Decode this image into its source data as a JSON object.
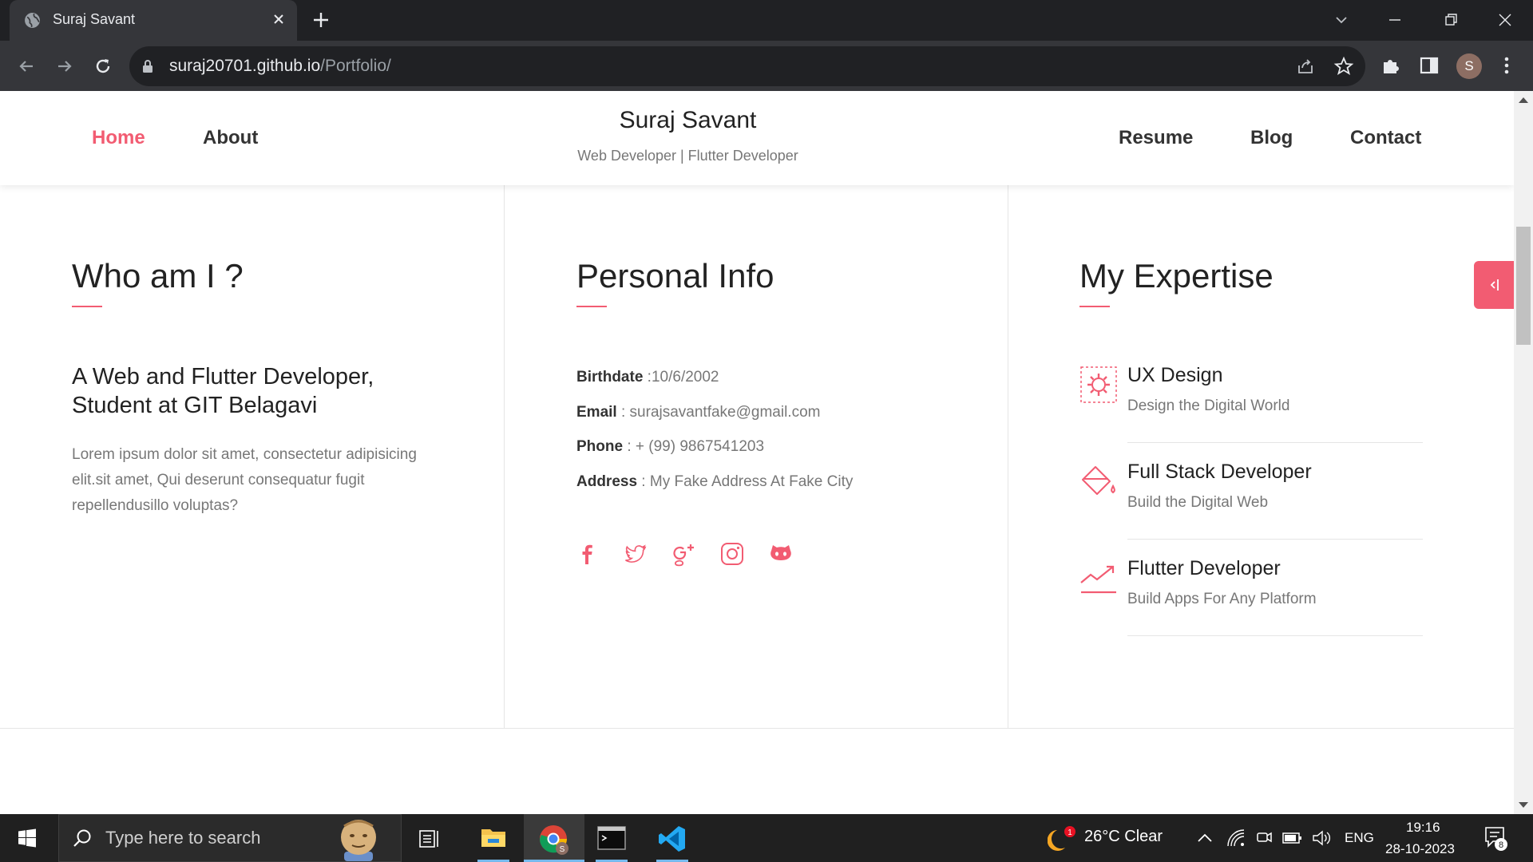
{
  "browser": {
    "tab_title": "Suraj Savant",
    "url_host": "suraj20701.github.io",
    "url_path": "/Portfolio/",
    "profile_initial": "S"
  },
  "header": {
    "nav_left": [
      "Home",
      "About"
    ],
    "nav_right": [
      "Resume",
      "Blog",
      "Contact"
    ],
    "brand_name": "Suraj Savant",
    "brand_sub": "Web Developer | Flutter Developer"
  },
  "about": {
    "title": "Who am I ?",
    "heading_line1": "A Web and Flutter Developer,",
    "heading_line2": "Student at GIT Belagavi",
    "text": "Lorem ipsum dolor sit amet, consectetur adipisicing elit.sit amet, Qui deserunt consequatur fugit repellendusillo voluptas?"
  },
  "personal": {
    "title": "Personal Info",
    "rows": [
      {
        "label": "Birthdate",
        "sep": " :",
        "value": "10/6/2002"
      },
      {
        "label": "Email",
        "sep": " : ",
        "value": "surajsavantfake@gmail.com"
      },
      {
        "label": "Phone",
        "sep": " : ",
        "value": "+ (99) 9867541203"
      },
      {
        "label": "Address",
        "sep": " : ",
        "value": "My Fake Address At Fake City"
      }
    ],
    "social_icons": [
      "facebook-icon",
      "twitter-icon",
      "google-plus-icon",
      "instagram-icon",
      "github-icon"
    ]
  },
  "expertise": {
    "title": "My Expertise",
    "items": [
      {
        "title": "UX Design",
        "sub": "Design the Digital World",
        "icon": "gear-icon"
      },
      {
        "title": "Full Stack Developer",
        "sub": "Build the Digital Web",
        "icon": "paint-bucket-icon"
      },
      {
        "title": "Flutter Developer",
        "sub": "Build Apps For Any Platform",
        "icon": "trend-chart-icon"
      }
    ]
  },
  "taskbar": {
    "search_placeholder": "Type here to search",
    "weather": "26°C  Clear",
    "weather_badge": "1",
    "lang": "ENG",
    "time": "19:16",
    "date": "28-10-2023",
    "notif_count": "8"
  },
  "colors": {
    "accent": "#f25c72",
    "chrome_dark": "#202124",
    "chrome_toolbar": "#35363a"
  }
}
